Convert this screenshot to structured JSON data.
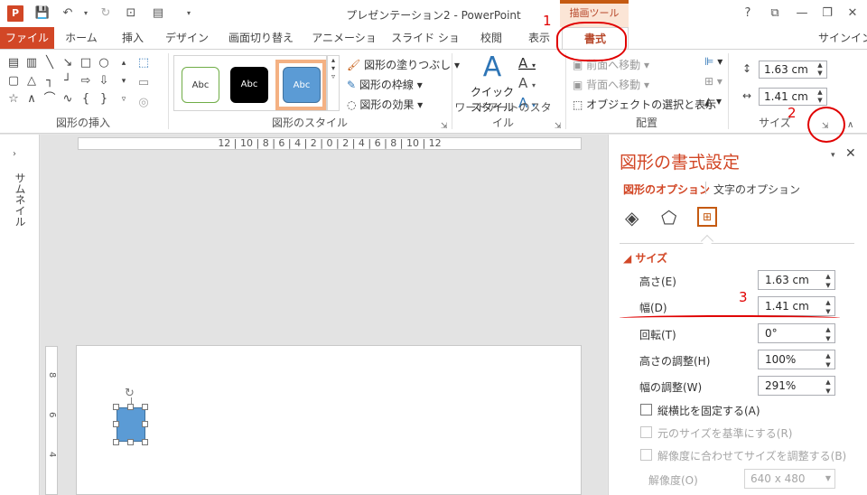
{
  "window": {
    "title": "プレゼンテーション2 - PowerPoint",
    "context_tab_label": "描画ツール",
    "controls": [
      "?",
      "⧉",
      "—",
      "❐",
      "✕"
    ]
  },
  "quick_access": {
    "app_icon_letter": "P"
  },
  "tabs": [
    "ファイル",
    "ホーム",
    "挿入",
    "デザイン",
    "画面切り替え",
    "アニメーション",
    "スライド ショー",
    "校閲",
    "表示",
    "書式"
  ],
  "signin": "サインイン",
  "ribbon": {
    "insert_shapes_label": "図形の挿入",
    "styles_label": "図形のスタイル",
    "style_samples": [
      "Abc",
      "Abc",
      "Abc"
    ],
    "fill": "図形の塗りつぶし",
    "outline": "図形の枠線",
    "effects": "図形の効果",
    "wordart_label": "ワードアートのスタイル",
    "quick_styles": "クイック",
    "quick_styles2": "スタイル",
    "arrange_label": "配置",
    "bring_forward": "前面へ移動",
    "send_backward": "背面へ移動",
    "selection_pane": "オブジェクトの選択と表示",
    "size_label": "サイズ",
    "height": "1.63 cm",
    "width": "1.41 cm"
  },
  "thumbnails_label": "サムネイル",
  "ruler": "12 | 10 | 8 | 6 | 4 | 2 | 0 | 2 | 4 | 6 | 8 | 10 | 12",
  "vruler": [
    "8",
    "6",
    "4"
  ],
  "pane": {
    "title": "図形の書式設定",
    "tab_shape": "図形のオプション",
    "tab_text": "文字のオプション",
    "section": "サイズ",
    "rows": [
      {
        "label": "高さ(E)",
        "value": "1.63 cm"
      },
      {
        "label": "幅(D)",
        "value": "1.41 cm"
      },
      {
        "label": "回転(T)",
        "value": "0°"
      },
      {
        "label": "高さの調整(H)",
        "value": "100%"
      },
      {
        "label": "幅の調整(W)",
        "value": "291%"
      }
    ],
    "lock_aspect": "縦横比を固定する(A)",
    "relative_original": "元のサイズを基準にする(R)",
    "best_scale": "解像度に合わせてサイズを調整する(B)",
    "resolution_label": "解像度(O)",
    "resolution_value": "640 x 480"
  },
  "annotations": [
    "1",
    "2",
    "3"
  ],
  "colors": {
    "accent": "#d24726",
    "shape_fill": "#5b9bd5",
    "annotation": "#e00000"
  }
}
